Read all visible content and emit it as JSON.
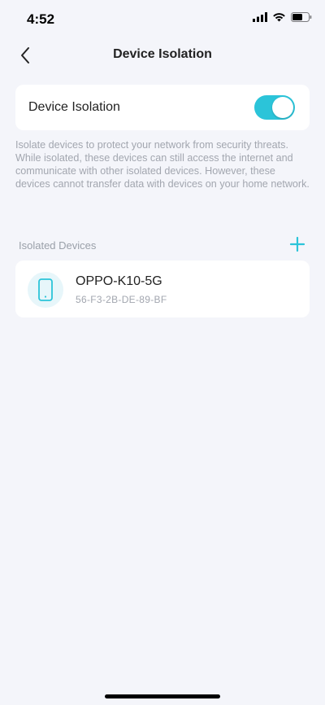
{
  "status_bar": {
    "time": "4:52",
    "icons": [
      "signal-icon",
      "wifi-icon",
      "battery-icon"
    ]
  },
  "nav": {
    "title": "Device Isolation",
    "back_icon": "chevron-left-icon"
  },
  "toggle_card": {
    "label": "Device Isolation",
    "enabled": true,
    "accent_color": "#2bc4d9"
  },
  "description": "Isolate devices to protect your network from security threats. While isolated, these devices can still access the internet and communicate with other isolated devices. However, these devices cannot transfer data with devices on your home network.",
  "isolated_section": {
    "header": "Isolated Devices",
    "add_icon": "plus-icon",
    "devices": [
      {
        "name": "OPPO-K10-5G",
        "mac": "56-F3-2B-DE-89-BF",
        "icon": "phone-icon"
      }
    ]
  }
}
